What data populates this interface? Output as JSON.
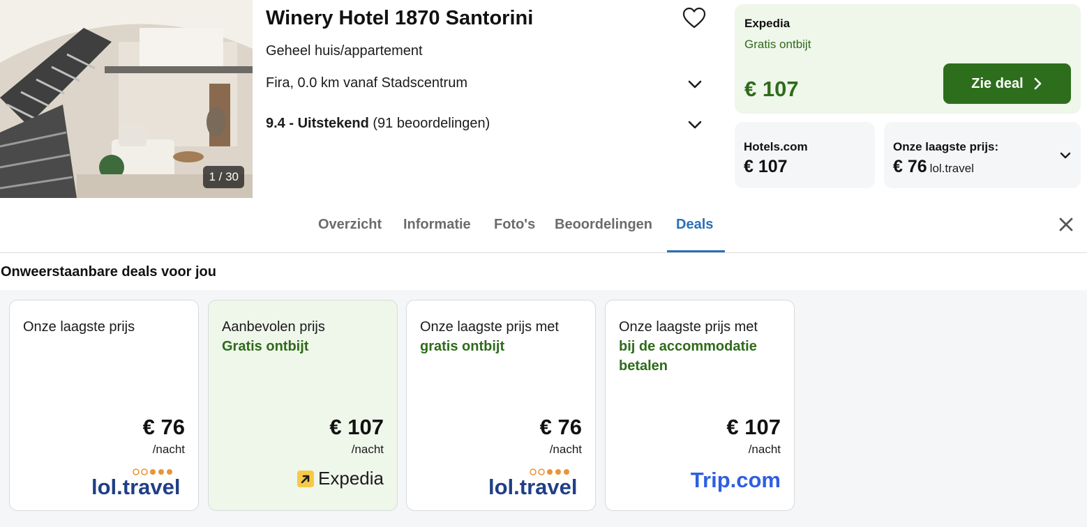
{
  "hotel": {
    "name": "Winery Hotel 1870 Santorini",
    "property_type": "Geheel huis/appartement",
    "location": "Fira, 0.0 km vanaf Stadscentrum",
    "rating_score_label": "9.4 - Uitstekend",
    "rating_reviews": "(91 beoordelingen)",
    "photo_counter": "1 / 30"
  },
  "top_deal": {
    "provider": "Expedia",
    "perk": "Gratis ontbijt",
    "price": "€ 107",
    "cta_label": "Zie deal"
  },
  "alt_deals": [
    {
      "provider": "Hotels.com",
      "price": "€ 107"
    },
    {
      "provider": "Onze laagste prijs:",
      "price": "€ 76",
      "source": "lol.travel"
    }
  ],
  "tabs": [
    {
      "label": "Overzicht",
      "active": false
    },
    {
      "label": "Informatie",
      "active": false
    },
    {
      "label": "Foto's",
      "active": false
    },
    {
      "label": "Beoordelingen",
      "active": false
    },
    {
      "label": "Deals",
      "active": true
    }
  ],
  "deals_section": {
    "title": "Onweerstaanbare deals voor jou",
    "cards": [
      {
        "label": "Onze laagste prijs",
        "perk": "",
        "price": "€ 76",
        "per_night": "/nacht",
        "logo": "lol.travel"
      },
      {
        "label": "Aanbevolen prijs",
        "perk": "Gratis ontbijt",
        "price": "€ 107",
        "per_night": "/nacht",
        "logo": "Expedia"
      },
      {
        "label": "Onze laagste prijs met",
        "perk": "gratis ontbijt",
        "price": "€ 76",
        "per_night": "/nacht",
        "logo": "lol.travel"
      },
      {
        "label": "Onze laagste prijs met",
        "perk": "bij de accommodatie betalen",
        "price": "€ 107",
        "per_night": "/nacht",
        "logo": "Trip.com"
      }
    ]
  },
  "colors": {
    "accent_green": "#2d6e1c",
    "perk_green": "#2e6b1a",
    "tab_active_blue": "#2a6fb5",
    "recommended_bg": "#eff6ea"
  },
  "icons": [
    "heart-icon",
    "chevron-down-icon",
    "chevron-right-icon",
    "close-icon",
    "expedia-logo-icon"
  ]
}
